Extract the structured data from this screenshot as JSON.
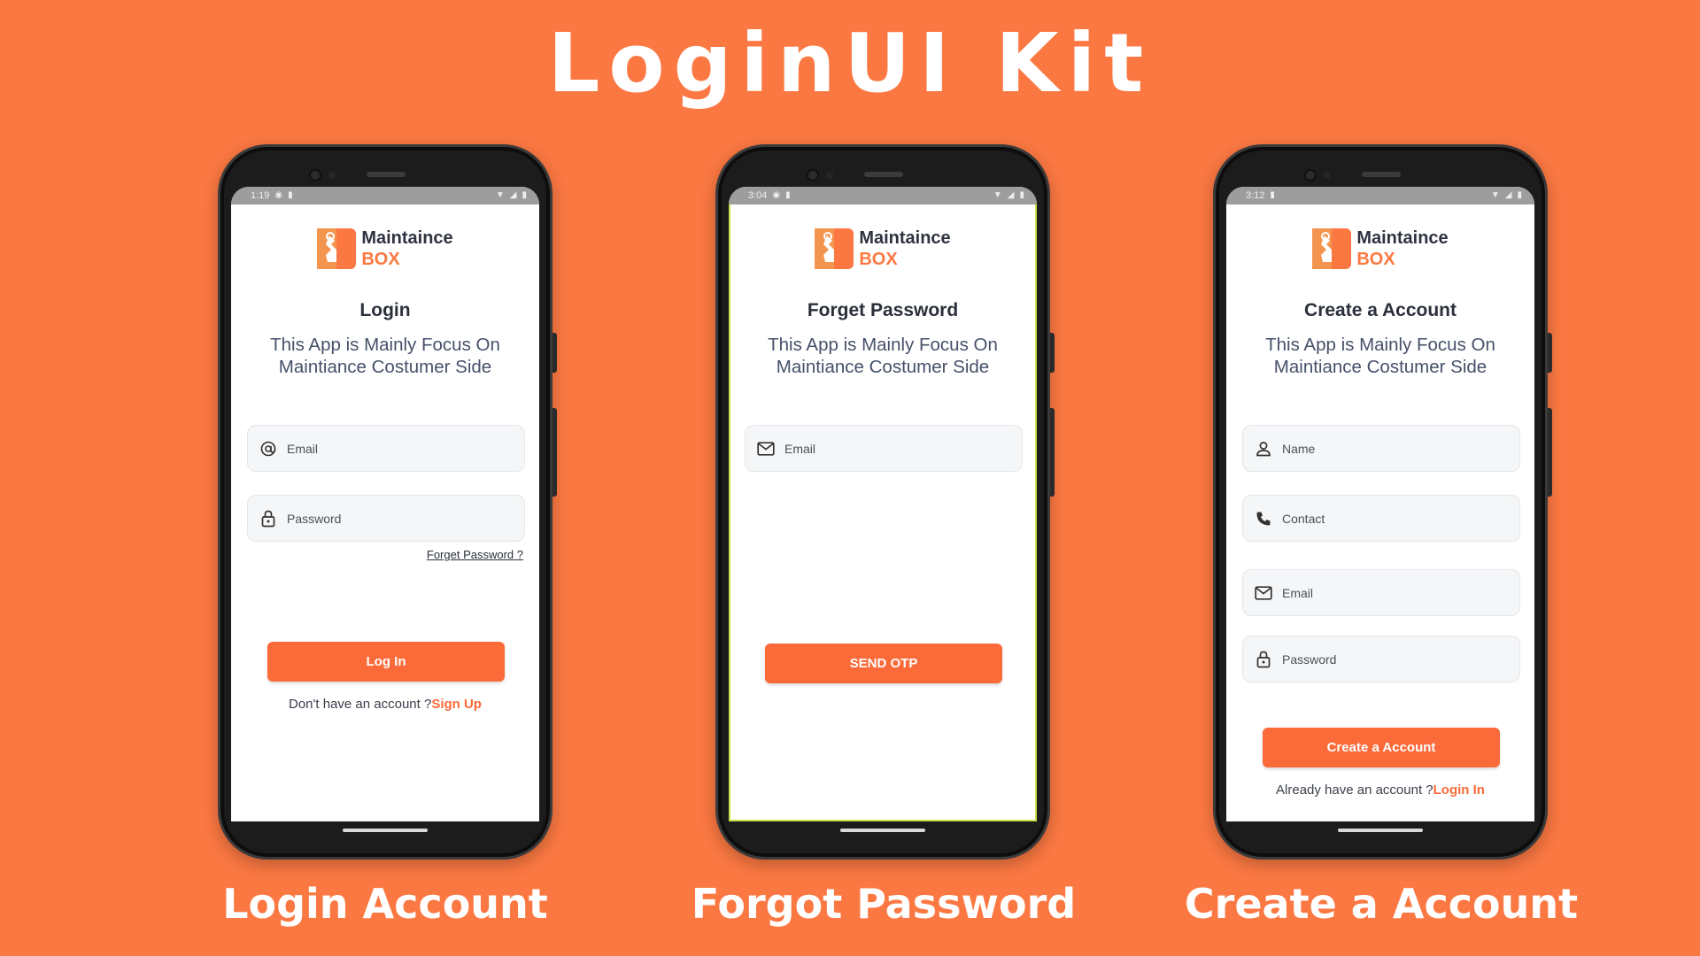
{
  "title": "LoginUI Kit",
  "colors": {
    "background": "#fb7842",
    "accent": "#fb6a39",
    "brand_text": "#2f3340"
  },
  "brand": {
    "name": "Maintaince",
    "sub": "BOX"
  },
  "phones": [
    {
      "caption": "Login Account",
      "status": {
        "time": "1:19"
      },
      "screen_title": "Login",
      "desc_line1": "This App is Mainly Focus On",
      "desc_line2": "Maintiance Costumer Side",
      "fields": [
        {
          "icon": "at-icon",
          "placeholder": "Email"
        },
        {
          "icon": "lock-icon",
          "placeholder": "Password"
        }
      ],
      "forget_link": "Forget Password ?",
      "button": "Log In",
      "footer_text": "Don't have an account ?",
      "footer_link": "Sign Up"
    },
    {
      "caption": "Forgot Password",
      "status": {
        "time": "3:04"
      },
      "screen_title": "Forget Password",
      "desc_line1": "This App is Mainly Focus On",
      "desc_line2": "Maintiance Costumer Side",
      "fields": [
        {
          "icon": "mail-icon",
          "placeholder": "Email"
        }
      ],
      "button": "SEND OTP"
    },
    {
      "caption": "Create a Account",
      "status": {
        "time": "3:12"
      },
      "screen_title": "Create a Account",
      "desc_line1": "This App is Mainly Focus On",
      "desc_line2": "Maintiance Costumer Side",
      "fields": [
        {
          "icon": "person-icon",
          "placeholder": "Name"
        },
        {
          "icon": "phone-icon",
          "placeholder": "Contact"
        },
        {
          "icon": "mail-icon",
          "placeholder": "Email"
        },
        {
          "icon": "lock-icon",
          "placeholder": "Password"
        }
      ],
      "button": "Create a Account",
      "footer_text": "Already have an account ?",
      "footer_link": "Login In"
    }
  ]
}
